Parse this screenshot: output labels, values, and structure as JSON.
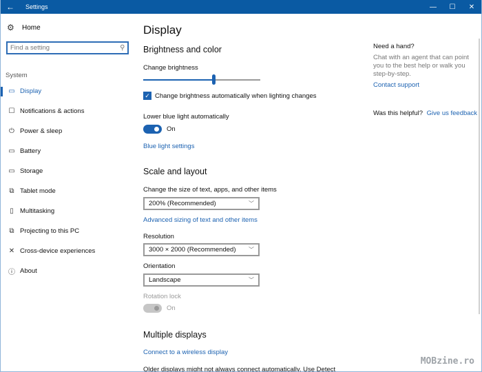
{
  "window": {
    "title": "Settings",
    "controls": {
      "back": "←",
      "minimize": "—",
      "maximize": "☐",
      "close": "✕"
    }
  },
  "sidebar": {
    "home_label": "Home",
    "search_placeholder": "Find a setting",
    "section_label": "System",
    "items": [
      {
        "label": "Display",
        "icon": "display-icon",
        "glyph": "▭",
        "active": true
      },
      {
        "label": "Notifications & actions",
        "icon": "notifications-icon",
        "glyph": "☐",
        "active": false
      },
      {
        "label": "Power & sleep",
        "icon": "power-icon",
        "glyph": "⏻",
        "active": false
      },
      {
        "label": "Battery",
        "icon": "battery-icon",
        "glyph": "▭",
        "active": false
      },
      {
        "label": "Storage",
        "icon": "storage-icon",
        "glyph": "▭",
        "active": false
      },
      {
        "label": "Tablet mode",
        "icon": "tablet-mode-icon",
        "glyph": "⧉",
        "active": false
      },
      {
        "label": "Multitasking",
        "icon": "multitasking-icon",
        "glyph": "▯",
        "active": false
      },
      {
        "label": "Projecting to this PC",
        "icon": "projecting-icon",
        "glyph": "⧉",
        "active": false
      },
      {
        "label": "Cross-device experiences",
        "icon": "cross-device-icon",
        "glyph": "✕",
        "active": false
      },
      {
        "label": "About",
        "icon": "info-icon",
        "glyph": "ⓘ",
        "active": false
      }
    ]
  },
  "main": {
    "page_title": "Display",
    "brightness": {
      "heading": "Brightness and color",
      "slider_label": "Change brightness",
      "brightness_percent": 60,
      "auto_checkbox_label": "Change brightness automatically when lighting changes",
      "auto_checked": true,
      "blue_light_label": "Lower blue light automatically",
      "blue_light_state": "On",
      "blue_light_link": "Blue light settings"
    },
    "scale": {
      "heading": "Scale and layout",
      "size_label": "Change the size of text, apps, and other items",
      "size_value": "200% (Recommended)",
      "advanced_link": "Advanced sizing of text and other items",
      "resolution_label": "Resolution",
      "resolution_value": "3000 × 2000 (Recommended)",
      "orientation_label": "Orientation",
      "orientation_value": "Landscape",
      "rotation_lock_label": "Rotation lock",
      "rotation_lock_state": "On"
    },
    "multiple": {
      "heading": "Multiple displays",
      "wireless_link": "Connect to a wireless display",
      "older_text": "Older displays might not always connect automatically. Use Detect"
    }
  },
  "aside": {
    "title": "Need a hand?",
    "description": "Chat with an agent that can point you to the best help or walk you step-by-step.",
    "contact_link": "Contact support",
    "helpful_label": "Was this helpful?",
    "feedback_link": "Give us feedback"
  },
  "watermark": "MOBzine.ro",
  "colors": {
    "accent": "#1c62b1",
    "titlebar": "#0a5aa3"
  }
}
